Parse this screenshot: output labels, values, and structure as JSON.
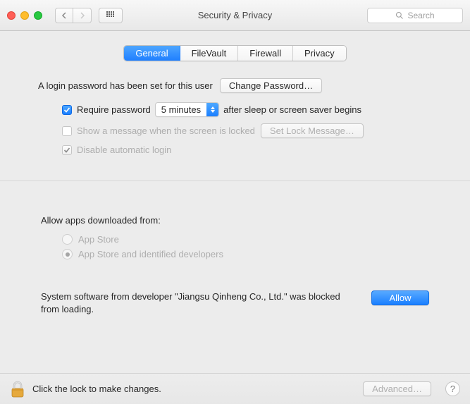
{
  "window": {
    "title": "Security & Privacy"
  },
  "search": {
    "placeholder": "Search"
  },
  "tabs": {
    "general": "General",
    "filevault": "FileVault",
    "firewall": "Firewall",
    "privacy": "Privacy"
  },
  "login": {
    "status": "A login password has been set for this user",
    "change_button": "Change Password…",
    "require_prefix": "Require password",
    "delay_value": "5 minutes",
    "require_suffix": "after sleep or screen saver begins",
    "show_message": "Show a message when the screen is locked",
    "set_lock_button": "Set Lock Message…",
    "disable_autologin": "Disable automatic login"
  },
  "gatekeeper": {
    "label": "Allow apps downloaded from:",
    "appstore": "App Store",
    "identified": "App Store and identified developers"
  },
  "blocked": {
    "message": "System software from developer \"Jiangsu Qinheng Co., Ltd.\" was blocked from loading.",
    "allow_button": "Allow"
  },
  "footer": {
    "lock_message": "Click the lock to make changes.",
    "advanced_button": "Advanced…",
    "help": "?"
  }
}
